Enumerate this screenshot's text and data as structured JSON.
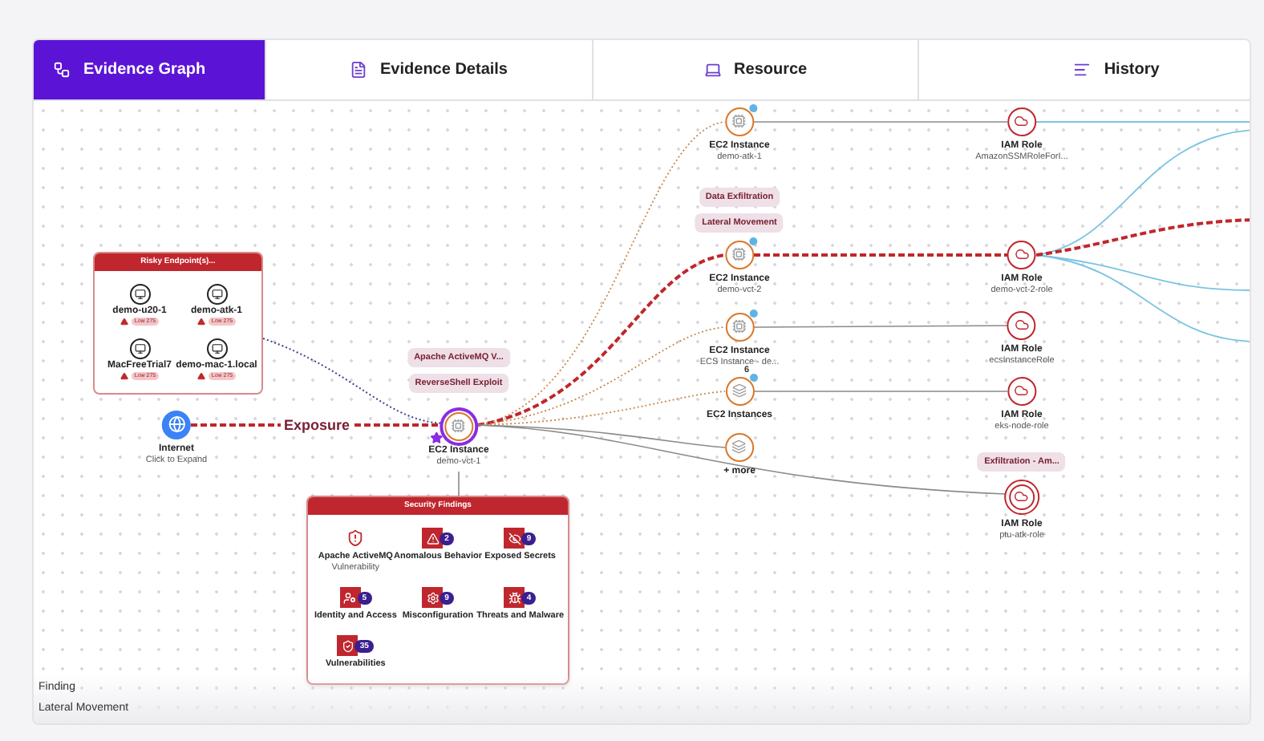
{
  "tabs": [
    {
      "label": "Evidence Graph",
      "selected": true
    },
    {
      "label": "Evidence Details",
      "selected": false
    },
    {
      "label": "Resource",
      "selected": false
    },
    {
      "label": "History",
      "selected": false
    }
  ],
  "graph": {
    "edge_label": "Exposure",
    "endpoints_card": {
      "title": "Risky Endpoint(s)...",
      "items": [
        {
          "name": "demo-u20-1",
          "risk": "Low 275"
        },
        {
          "name": "demo-atk-1",
          "risk": "Low 275"
        },
        {
          "name": "MacFreeTrial7",
          "risk": "Low 275"
        },
        {
          "name": "demo-mac-1.local",
          "risk": "Low 275"
        }
      ]
    },
    "nodes": [
      {
        "kind": "internet",
        "title": "Internet",
        "subtitle": "Click to Expand",
        "selected": false,
        "alert": false
      },
      {
        "kind": "ec2",
        "title": "EC2 Instance",
        "subtitle": "demo-vct-1",
        "selected": true,
        "alert": false,
        "tags": [
          "Apache ActiveMQ V...",
          "ReverseShell Exploit"
        ]
      },
      {
        "kind": "ec2",
        "title": "EC2 Instance",
        "subtitle": "demo-atk-1",
        "selected": false,
        "alert": true
      },
      {
        "kind": "ec2",
        "title": "EC2 Instance",
        "subtitle": "demo-vct-2",
        "selected": false,
        "alert": true,
        "tags": [
          "Data Exfiltration",
          "Lateral Movement"
        ]
      },
      {
        "kind": "ec2",
        "title": "EC2 Instance",
        "subtitle": "ECS Instance - de...",
        "selected": false,
        "alert": true
      },
      {
        "kind": "group",
        "title": "EC2 Instances",
        "count": "6",
        "selected": false,
        "alert": true
      },
      {
        "kind": "more",
        "title": "+ more",
        "selected": false,
        "alert": false
      },
      {
        "kind": "iam",
        "title": "IAM Role",
        "subtitle": "AmazonSSMRoleForI...",
        "selected": false,
        "alert": false
      },
      {
        "kind": "iam",
        "title": "IAM Role",
        "subtitle": "demo-vct-2-role",
        "selected": false,
        "alert": false
      },
      {
        "kind": "iam",
        "title": "IAM Role",
        "subtitle": "ecsInstanceRole",
        "selected": false,
        "alert": false
      },
      {
        "kind": "iam",
        "title": "IAM Role",
        "subtitle": "eks-node-role",
        "selected": false,
        "alert": false
      },
      {
        "kind": "iam",
        "title": "IAM Role",
        "subtitle": "ptu-atk-role",
        "selected": true,
        "alert": false,
        "tags": [
          "Exfiltration - Am..."
        ]
      }
    ],
    "findings_card": {
      "title": "Security Findings",
      "items": [
        {
          "kind": "finding",
          "label": "Apache ActiveMQ",
          "sublabel": "Vulnerability"
        },
        {
          "kind": "category",
          "label": "Anomalous Behavior",
          "count": "2"
        },
        {
          "kind": "category",
          "label": "Exposed Secrets",
          "count": "9"
        },
        {
          "kind": "category",
          "label": "Identity and Access",
          "count": "5"
        },
        {
          "kind": "category",
          "label": "Misconfiguration",
          "count": "9"
        },
        {
          "kind": "category",
          "label": "Threats and Malware",
          "count": "4"
        },
        {
          "kind": "category",
          "label": "Vulnerabilities",
          "count": "35"
        }
      ]
    }
  },
  "legend": [
    "Finding",
    "Lateral Movement"
  ]
}
